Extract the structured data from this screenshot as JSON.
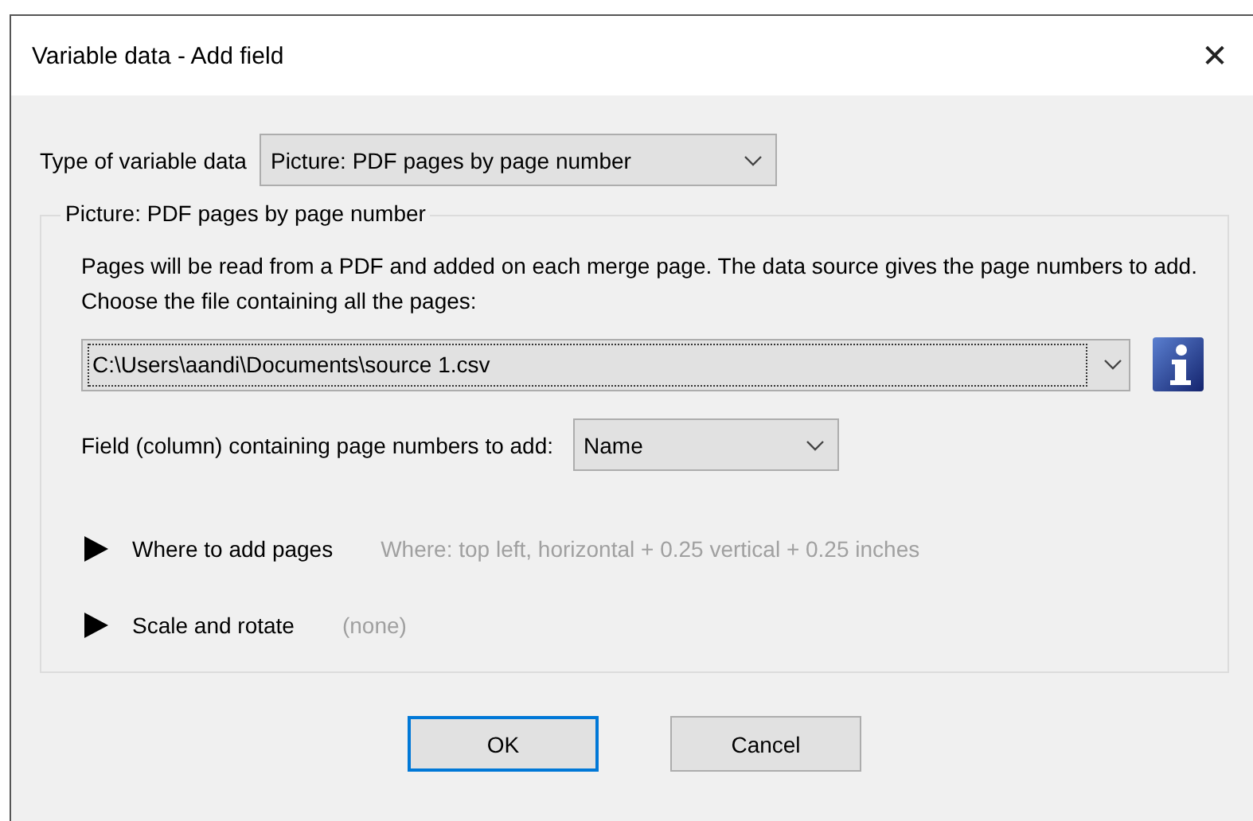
{
  "window": {
    "title": "Variable data - Add field",
    "close": "✕"
  },
  "type_row": {
    "label": "Type of variable data",
    "value": "Picture: PDF pages by page number"
  },
  "group": {
    "title": "Picture: PDF pages by page number",
    "description": "Pages will be read from a PDF and added on each merge page. The data source gives the page numbers to add. Choose the file containing all the pages:",
    "file": {
      "value": "C:\\Users\\aandi\\Documents\\source 1.csv"
    },
    "field_row": {
      "label": "Field (column) containing page numbers to add:",
      "value": "Name"
    },
    "sections": [
      {
        "label": "Where to add pages",
        "summary": "Where: top left, horizontal + 0.25 vertical + 0.25 inches",
        "expanded": false
      },
      {
        "label": "Scale and rotate",
        "summary": "(none)",
        "expanded": false
      }
    ]
  },
  "buttons": [
    {
      "label": "OK",
      "default": true
    },
    {
      "label": "Cancel",
      "default": false
    }
  ]
}
